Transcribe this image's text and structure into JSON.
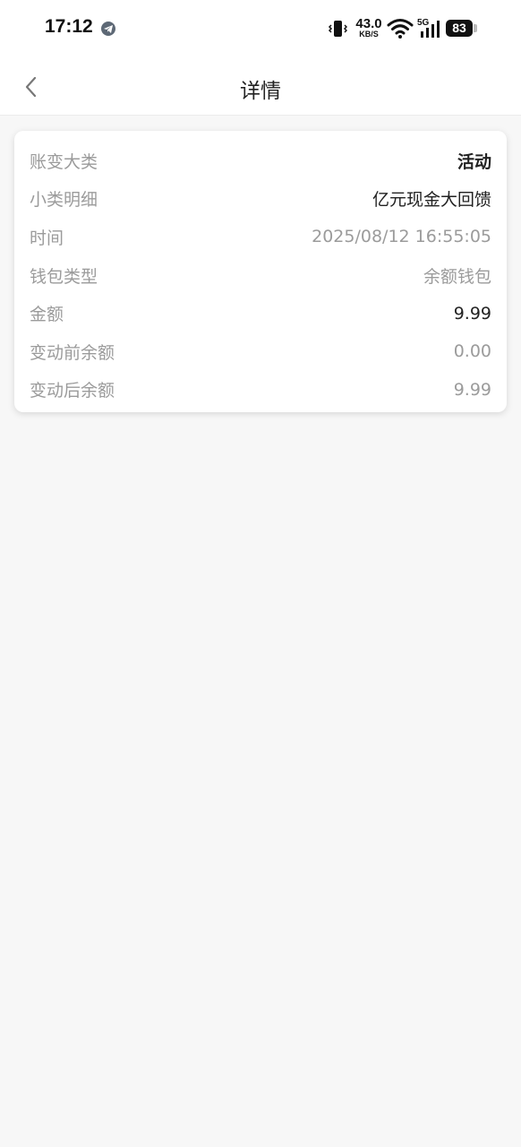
{
  "status_bar": {
    "time": "17:12",
    "net_speed_value": "43.0",
    "net_speed_unit": "KB/S",
    "signal_label": "5G",
    "battery": "83",
    "icons": [
      "telegram-icon",
      "vibrate-icon",
      "wifi-icon",
      "signal-icon",
      "battery-icon"
    ]
  },
  "header": {
    "title": "详情",
    "back_icon": "chevron-left-icon"
  },
  "details": {
    "category_label": "账变大类",
    "category_value": "活动",
    "subcategory_label": "小类明细",
    "subcategory_value": "亿元现金大回馈",
    "time_label": "时间",
    "time_value": "2025/08/12 16:55:05",
    "wallet_label": "钱包类型",
    "wallet_value": "余额钱包",
    "amount_label": "金额",
    "amount_value": "9.99",
    "before_label": "变动前余额",
    "before_value": "0.00",
    "after_label": "变动后余额",
    "after_value": "9.99"
  }
}
